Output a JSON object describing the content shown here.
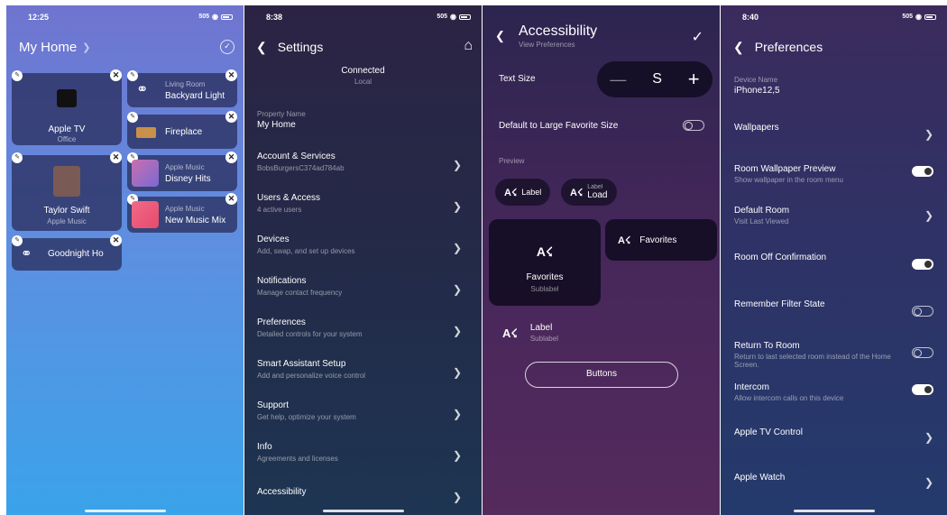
{
  "status": {
    "p1_time": "12:25",
    "p2_time": "8:38",
    "p4_time": "8:40",
    "signal": "505"
  },
  "panel1": {
    "title": "My Home",
    "tiles": [
      {
        "label": "Apple TV",
        "sub": "Office"
      },
      {
        "label": "Backyard Light",
        "sub": "Living Room"
      },
      {
        "label": "Fireplace",
        "sub": ""
      },
      {
        "label": "Taylor Swift",
        "sub": "Apple Music"
      },
      {
        "label": "Disney Hits",
        "sub": "Apple Music"
      },
      {
        "label": "New Music Mix",
        "sub": "Apple Music"
      },
      {
        "label": "Goodnight Ho",
        "sub": ""
      }
    ]
  },
  "panel2": {
    "title": "Settings",
    "connection": "Connected",
    "connection_type": "Local",
    "property_name_label": "Property Name",
    "property_name": "My Home",
    "rows": [
      {
        "title": "Account & Services",
        "desc": "BobsBurgersC374ad784ab"
      },
      {
        "title": "Users & Access",
        "desc": "4 active users"
      },
      {
        "title": "Devices",
        "desc": "Add, swap, and set up devices"
      },
      {
        "title": "Notifications",
        "desc": "Manage contact frequency"
      },
      {
        "title": "Preferences",
        "desc": "Detailed controls for your system"
      },
      {
        "title": "Smart Assistant Setup",
        "desc": "Add and personalize voice control"
      },
      {
        "title": "Support",
        "desc": "Get help, optimize your system"
      },
      {
        "title": "Info",
        "desc": "Agreements and licenses"
      },
      {
        "title": "Accessibility",
        "desc": ""
      }
    ]
  },
  "panel3": {
    "title": "Accessibility",
    "subtitle": "View Preferences",
    "text_size_label": "Text Size",
    "text_size_value": "S",
    "large_fav_label": "Default to Large Favorite Size",
    "preview_label": "Preview",
    "az": "A☇",
    "pill1_label": "Label",
    "pill2_small": "Label",
    "pill2_label": "Load",
    "fav_big_label": "Favorites",
    "fav_big_sub": "Sublabel",
    "fav_wide_label": "Favorites",
    "list_label": "Label",
    "list_sub": "Sublabel",
    "buttons_label": "Buttons"
  },
  "panel4": {
    "title": "Preferences",
    "device_name_label": "Device Name",
    "device_name": "iPhone12,5",
    "rows": [
      {
        "title": "Wallpapers",
        "desc": "",
        "control": "chevron"
      },
      {
        "title": "Room Wallpaper Preview",
        "desc": "Show wallpaper in the room menu",
        "control": "on"
      },
      {
        "title": "Default Room",
        "desc": "Visit Last Viewed",
        "control": "chevron"
      },
      {
        "title": "Room Off Confirmation",
        "desc": "",
        "control": "on"
      },
      {
        "title": "Remember Filter State",
        "desc": "",
        "control": "off"
      },
      {
        "title": "Return To Room",
        "desc": "Return to last selected room instead of the Home Screen.",
        "control": "off"
      },
      {
        "title": "Intercom",
        "desc": "Allow intercom calls on this device",
        "control": "on"
      },
      {
        "title": "Apple TV Control",
        "desc": "",
        "control": "chevron"
      },
      {
        "title": "Apple Watch",
        "desc": "",
        "control": "chevron"
      }
    ]
  }
}
